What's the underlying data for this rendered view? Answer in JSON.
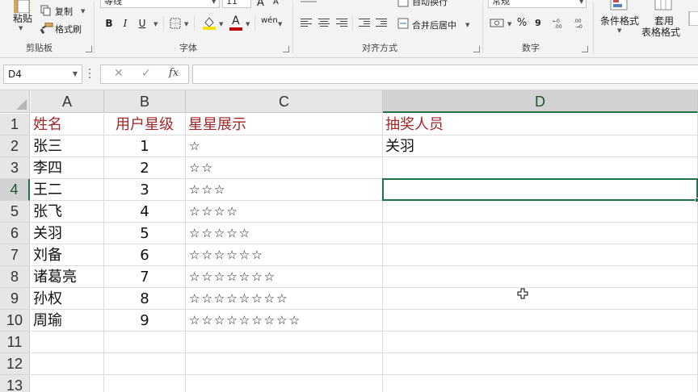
{
  "ribbon": {
    "clipboard": {
      "paste_label": "粘贴",
      "copy_label": "复制",
      "format_painter_label": "格式刷",
      "group_label": "剪贴板"
    },
    "font": {
      "font_name": "等线",
      "font_size": "11",
      "bold": "B",
      "italic": "I",
      "underline": "U",
      "font_color_glyph": "A",
      "grow_glyph": "A",
      "shrink_glyph": "A",
      "phonetic_glyph": "wén",
      "group_label": "字体"
    },
    "alignment": {
      "wrap_label": "自动换行",
      "merge_label": "合并后居中",
      "group_label": "对齐方式"
    },
    "number": {
      "format_value": "常规",
      "percent": "%",
      "comma": "9",
      "group_label": "数字"
    },
    "styles": {
      "conditional_label": "条件格式",
      "table_label_1": "套用",
      "table_label_2": "表格格式"
    },
    "colors": {
      "highlight": "#f5e300",
      "font_color": "#c00000"
    }
  },
  "formula_bar": {
    "name_box": "D4",
    "cancel_glyph": "✕",
    "enter_glyph": "✓",
    "fx_label": "fx",
    "value": ""
  },
  "sheet": {
    "columns": [
      "A",
      "B",
      "C",
      "D"
    ],
    "rows": [
      {
        "num": "1",
        "a": "姓名",
        "b": "用户星级",
        "c": "星星展示",
        "d": "抽奖人员"
      },
      {
        "num": "2",
        "a": "张三",
        "b": "1",
        "c": "☆",
        "d": "关羽"
      },
      {
        "num": "3",
        "a": "李四",
        "b": "2",
        "c": "☆☆",
        "d": ""
      },
      {
        "num": "4",
        "a": "王二",
        "b": "3",
        "c": "☆☆☆",
        "d": ""
      },
      {
        "num": "5",
        "a": "张飞",
        "b": "4",
        "c": "☆☆☆☆",
        "d": ""
      },
      {
        "num": "6",
        "a": "关羽",
        "b": "5",
        "c": "☆☆☆☆☆",
        "d": ""
      },
      {
        "num": "7",
        "a": "刘备",
        "b": "6",
        "c": "☆☆☆☆☆☆",
        "d": ""
      },
      {
        "num": "8",
        "a": "诸葛亮",
        "b": "7",
        "c": "☆☆☆☆☆☆☆",
        "d": ""
      },
      {
        "num": "9",
        "a": "孙权",
        "b": "8",
        "c": "☆☆☆☆☆☆☆☆",
        "d": ""
      },
      {
        "num": "10",
        "a": "周瑜",
        "b": "9",
        "c": "☆☆☆☆☆☆☆☆☆",
        "d": ""
      },
      {
        "num": "11",
        "a": "",
        "b": "",
        "c": "",
        "d": ""
      },
      {
        "num": "12",
        "a": "",
        "b": "",
        "c": "",
        "d": ""
      },
      {
        "num": "13",
        "a": "",
        "b": "",
        "c": "",
        "d": ""
      }
    ],
    "selected_column": "D",
    "selected_row": "4",
    "header_text_color": "#a0272a",
    "accent_color": "#217346"
  }
}
